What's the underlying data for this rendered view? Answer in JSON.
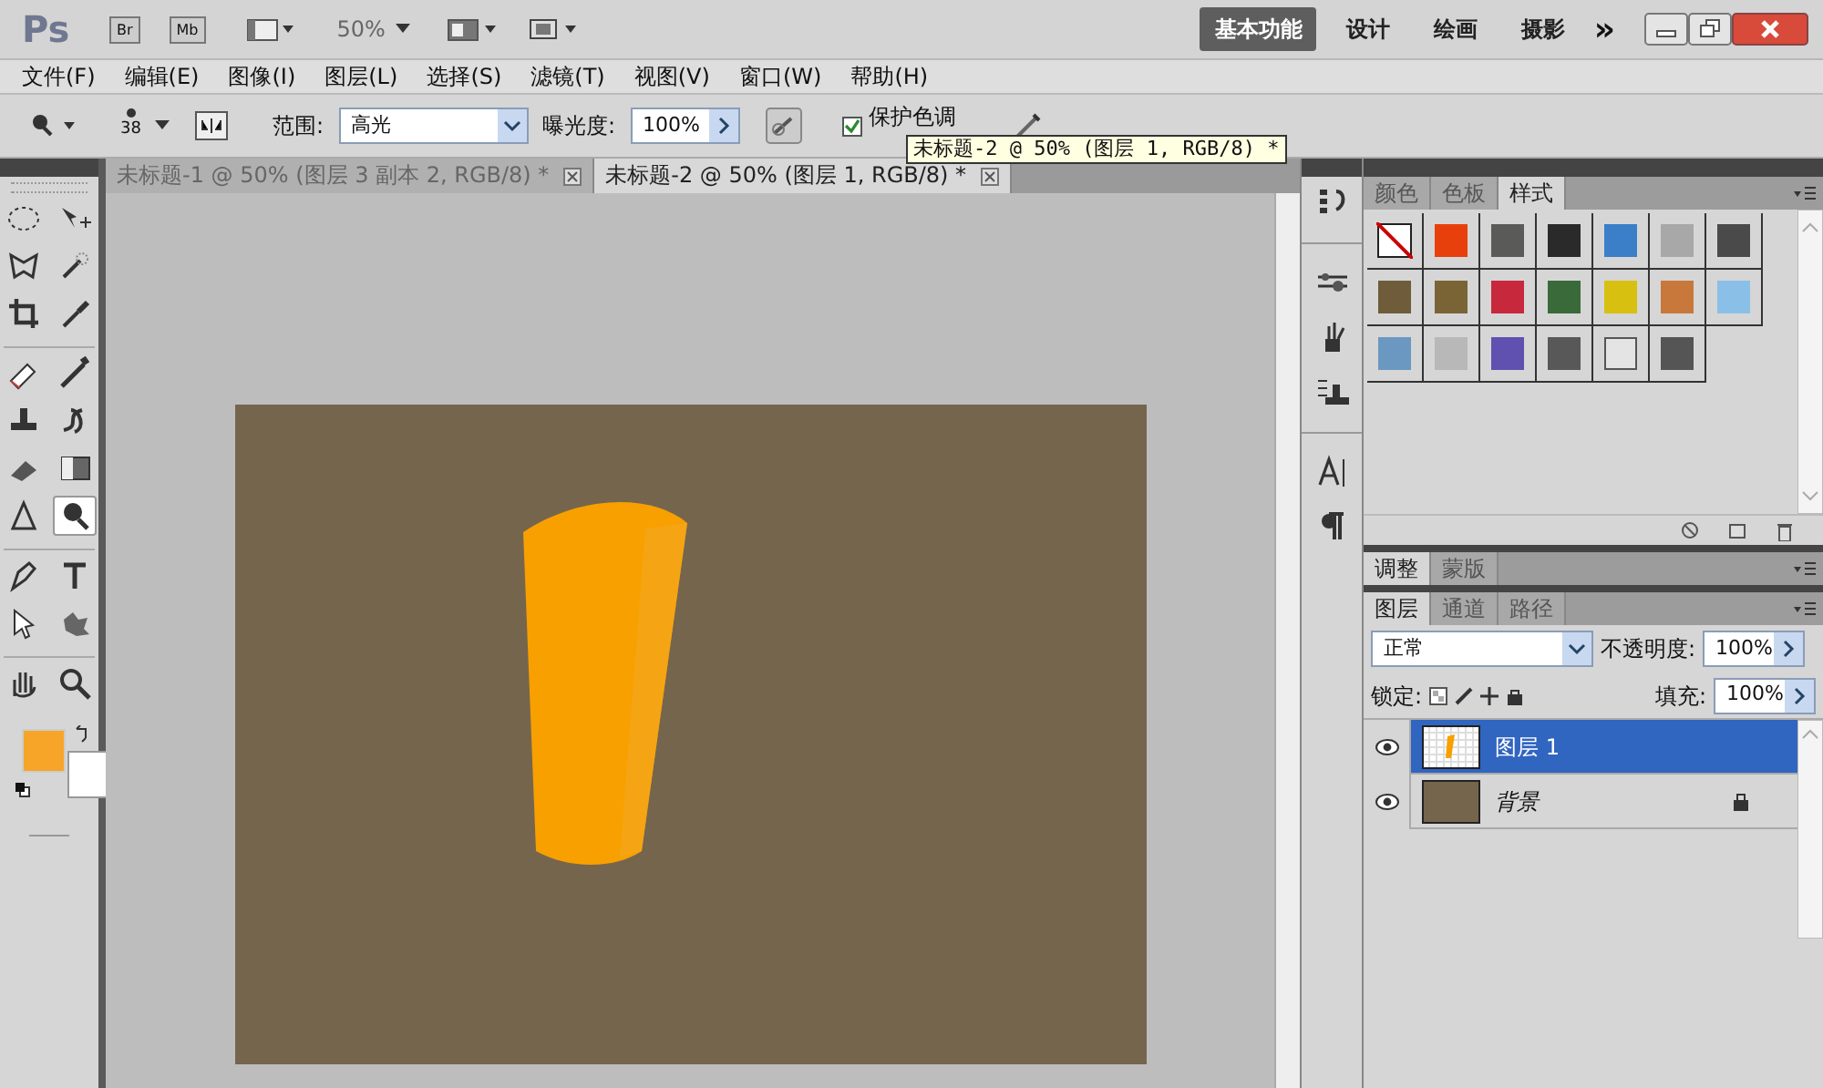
{
  "app_bar": {
    "logo": "Ps",
    "bridge_buttons": [
      "Br",
      "Mb"
    ],
    "zoom": "50%",
    "more": "»",
    "workspaces": [
      {
        "label": "基本功能",
        "selected": true
      },
      {
        "label": "设计",
        "selected": false
      },
      {
        "label": "绘画",
        "selected": false
      },
      {
        "label": "摄影",
        "selected": false
      }
    ]
  },
  "menu": [
    "文件(F)",
    "编辑(E)",
    "图像(I)",
    "图层(L)",
    "选择(S)",
    "滤镜(T)",
    "视图(V)",
    "窗口(W)",
    "帮助(H)"
  ],
  "options": {
    "brush_size": "38",
    "range_label": "范围:",
    "range_value": "高光",
    "exposure_label": "曝光度:",
    "exposure_value": "100%",
    "protect_tones": {
      "label": "保护色调",
      "checked": true
    }
  },
  "tooltip": "未标题-2 @ 50% (图层 1, RGB/8) *",
  "tools": [
    {
      "selected": false
    },
    {
      "selected": false
    },
    {
      "selected": false
    },
    {
      "selected": false
    },
    {
      "selected": false
    },
    {
      "selected": false
    },
    {
      "selected": false
    },
    {
      "selected": false
    },
    {
      "selected": false
    },
    {
      "selected": false
    },
    {
      "selected": false
    },
    {
      "selected": false
    },
    {
      "selected": false
    },
    {
      "selected": true
    },
    {
      "selected": false
    },
    {
      "selected": false
    },
    {
      "selected": false
    },
    {
      "selected": false
    },
    {
      "selected": false
    },
    {
      "selected": false
    }
  ],
  "color_swatches": [
    {
      "color": "#f7a529"
    },
    {
      "color": "#ffffff"
    }
  ],
  "documents": [
    {
      "label": "未标题-1 @ 50% (图层 3 副本 2, RGB/8) *",
      "selected": false
    },
    {
      "label": "未标题-2 @ 50% (图层 1, RGB/8) *",
      "selected": true
    }
  ],
  "styles_panel": {
    "tabs": [
      {
        "label": "颜色",
        "selected": false
      },
      {
        "label": "色板",
        "selected": false
      },
      {
        "label": "样式",
        "selected": true
      }
    ],
    "styles": [
      {
        "kind": "none",
        "color": "#ffffff"
      },
      {
        "kind": "swatch",
        "color": "#e8400c"
      },
      {
        "kind": "swatch",
        "color": "#5a5a58"
      },
      {
        "kind": "swatch",
        "color": "#2a2a2a"
      },
      {
        "kind": "swatch",
        "color": "#3a7fc8"
      },
      {
        "kind": "swatch",
        "color": "#a8a8a8"
      },
      {
        "kind": "swatch",
        "color": "#4a4a4a"
      },
      {
        "kind": "swatch",
        "color": "#6e5c3a"
      },
      {
        "kind": "swatch",
        "color": "#7a6436"
      },
      {
        "kind": "swatch",
        "color": "#c8283c"
      },
      {
        "kind": "swatch",
        "color": "#3a6a3a"
      },
      {
        "kind": "swatch",
        "color": "#d8c010"
      },
      {
        "kind": "swatch",
        "color": "#c8783a"
      },
      {
        "kind": "swatch",
        "color": "#8ac0e8"
      },
      {
        "kind": "swatch",
        "color": "#6a98c0"
      },
      {
        "kind": "swatch",
        "color": "#b8b8b8"
      },
      {
        "kind": "swatch",
        "color": "#6050b0"
      },
      {
        "kind": "swatch",
        "color": "#585858"
      },
      {
        "kind": "outline",
        "color": "#e4e4e4"
      },
      {
        "kind": "swatch",
        "color": "#555555"
      }
    ]
  },
  "adjust_panel": {
    "tabs": [
      {
        "label": "调整",
        "selected": true
      },
      {
        "label": "蒙版",
        "selected": false
      }
    ]
  },
  "layers_panel": {
    "tabs": [
      {
        "label": "图层",
        "selected": true
      },
      {
        "label": "通道",
        "selected": false
      },
      {
        "label": "路径",
        "selected": false
      }
    ],
    "blend_mode": "正常",
    "opacity_label": "不透明度:",
    "opacity": "100%",
    "lock_label": "锁定:",
    "fill_label": "填充:",
    "fill": "100%",
    "layers": [
      {
        "name": "图层 1",
        "kind": "pixel",
        "selected": true,
        "visible": true,
        "locked": false
      },
      {
        "name": "背景",
        "kind": "background",
        "selected": false,
        "visible": true,
        "locked": true
      }
    ]
  }
}
